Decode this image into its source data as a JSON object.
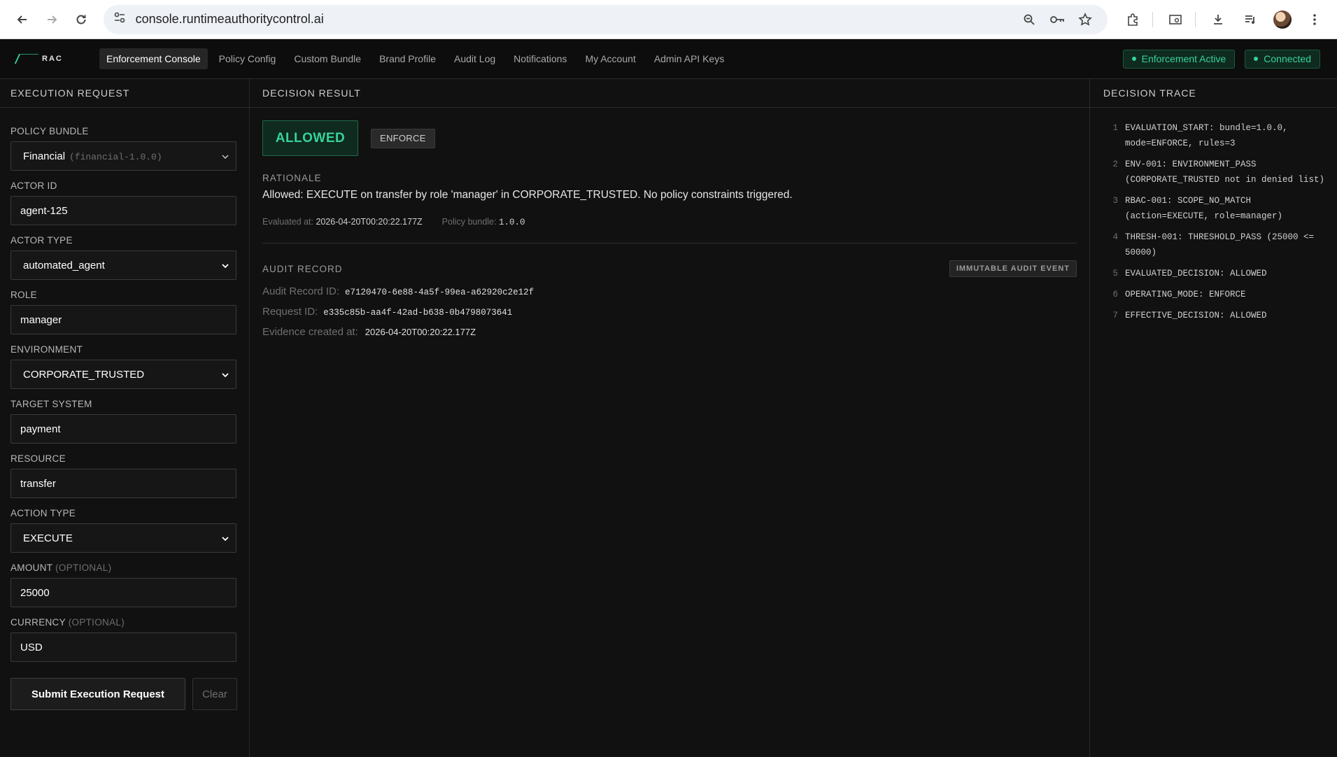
{
  "browser": {
    "url": "console.runtimeauthoritycontrol.ai"
  },
  "header": {
    "logo_text": "RAC",
    "nav": [
      {
        "label": "Enforcement Console",
        "active": true
      },
      {
        "label": "Policy Config",
        "active": false
      },
      {
        "label": "Custom Bundle",
        "active": false
      },
      {
        "label": "Brand Profile",
        "active": false
      },
      {
        "label": "Audit Log",
        "active": false
      },
      {
        "label": "Notifications",
        "active": false
      },
      {
        "label": "My Account",
        "active": false
      },
      {
        "label": "Admin API Keys",
        "active": false
      }
    ],
    "status": [
      {
        "label": "Enforcement Active"
      },
      {
        "label": "Connected"
      }
    ]
  },
  "request": {
    "title": "EXECUTION REQUEST",
    "policy_bundle_label": "POLICY BUNDLE",
    "policy_bundle_value": "Financial",
    "policy_bundle_sub": "(financial-1.0.0)",
    "actor_id_label": "ACTOR ID",
    "actor_id_value": "agent-125",
    "actor_type_label": "ACTOR TYPE",
    "actor_type_value": "automated_agent",
    "role_label": "ROLE",
    "role_value": "manager",
    "environment_label": "ENVIRONMENT",
    "environment_value": "CORPORATE_TRUSTED",
    "target_system_label": "TARGET SYSTEM",
    "target_system_value": "payment",
    "resource_label": "RESOURCE",
    "resource_value": "transfer",
    "action_type_label": "ACTION TYPE",
    "action_type_value": "EXECUTE",
    "amount_label": "AMOUNT",
    "amount_optional": "(OPTIONAL)",
    "amount_value": "25000",
    "currency_label": "CURRENCY",
    "currency_optional": "(OPTIONAL)",
    "currency_value": "USD",
    "submit_label": "Submit Execution Request",
    "clear_label": "Clear"
  },
  "decision": {
    "title": "DECISION RESULT",
    "result": "ALLOWED",
    "mode": "ENFORCE",
    "rationale_label": "RATIONALE",
    "rationale_text": "Allowed: EXECUTE on transfer by role 'manager' in CORPORATE_TRUSTED. No policy constraints triggered.",
    "evaluated_at_key": "Evaluated at:",
    "evaluated_at_val": "2026-04-20T00:20:22.177Z",
    "policy_bundle_key": "Policy bundle:",
    "policy_bundle_val": "1.0.0",
    "audit_label": "AUDIT RECORD",
    "immutable_label": "IMMUTABLE AUDIT EVENT",
    "audit_record_key": "Audit Record ID:",
    "audit_record_val": "e7120470-6e88-4a5f-99ea-a62920c2e12f",
    "request_id_key": "Request ID:",
    "request_id_val": "e335c85b-aa4f-42ad-b638-0b4798073641",
    "evidence_key": "Evidence created at:",
    "evidence_val": "2026-04-20T00:20:22.177Z"
  },
  "trace": {
    "title": "DECISION TRACE",
    "items": [
      {
        "num": "1",
        "text": "EVALUATION_START: bundle=1.0.0, mode=ENFORCE, rules=3"
      },
      {
        "num": "2",
        "text": "ENV-001: ENVIRONMENT_PASS (CORPORATE_TRUSTED not in denied list)"
      },
      {
        "num": "3",
        "text": "RBAC-001: SCOPE_NO_MATCH (action=EXECUTE, role=manager)"
      },
      {
        "num": "4",
        "text": "THRESH-001: THRESHOLD_PASS (25000 <= 50000)"
      },
      {
        "num": "5",
        "text": "EVALUATED_DECISION: ALLOWED"
      },
      {
        "num": "6",
        "text": "OPERATING_MODE: ENFORCE"
      },
      {
        "num": "7",
        "text": "EFFECTIVE_DECISION: ALLOWED"
      }
    ]
  },
  "colors": {
    "accent": "#36d399",
    "background": "#111111"
  }
}
